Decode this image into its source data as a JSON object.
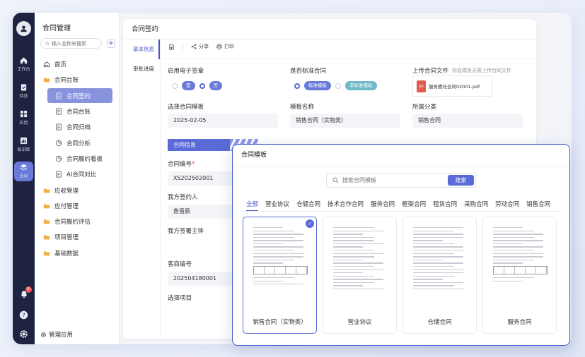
{
  "rail": {
    "items": [
      {
        "label": "工作台",
        "icon": "home-icon"
      },
      {
        "label": "待办",
        "icon": "clipboard-icon"
      },
      {
        "label": "应用",
        "icon": "grid-icon"
      },
      {
        "label": "知识库",
        "icon": "chart-icon"
      },
      {
        "label": "合同",
        "icon": "layers-icon",
        "active": true
      }
    ],
    "notification_count": "9"
  },
  "tree": {
    "title": "合同管理",
    "search_placeholder": "输入名称来搜索",
    "add_label": "+",
    "items": [
      {
        "label": "首页",
        "level": 0,
        "icon": "home-outline-icon"
      },
      {
        "label": "合同台账",
        "level": 0,
        "icon": "folder-icon"
      },
      {
        "label": "合同签约",
        "level": 1,
        "icon": "doc-icon",
        "selected": true
      },
      {
        "label": "合同台账",
        "level": 1,
        "icon": "doc-icon"
      },
      {
        "label": "合同归档",
        "level": 1,
        "icon": "doc-icon"
      },
      {
        "label": "合同分析",
        "level": 1,
        "icon": "pie-icon"
      },
      {
        "label": "合同履约看板",
        "level": 1,
        "icon": "pie-icon"
      },
      {
        "label": "AI合同对比",
        "level": 1,
        "icon": "doc-icon"
      },
      {
        "label": "应收管理",
        "level": 0,
        "icon": "folder-icon"
      },
      {
        "label": "应付管理",
        "level": 0,
        "icon": "folder-icon"
      },
      {
        "label": "合同履约评估",
        "level": 0,
        "icon": "folder-icon"
      },
      {
        "label": "项目管理",
        "level": 0,
        "icon": "folder-icon"
      },
      {
        "label": "基础数据",
        "level": 0,
        "icon": "folder-icon"
      }
    ],
    "footer_label": "管理应用"
  },
  "main": {
    "title": "合同签约",
    "vtabs": [
      {
        "label": "基本信息",
        "active": true
      },
      {
        "label": "审批进度",
        "active": false
      }
    ],
    "toolbar": {
      "share": "分享",
      "print": "打印"
    },
    "fields": {
      "esign_label": "启用电子签章",
      "esign_yes": "是",
      "esign_no": "否",
      "standard_label": "是否标准合同",
      "standard_opt1": "标准模板",
      "standard_opt2": "非标准模板",
      "upload_label": "上传合同文件",
      "upload_hint": "标准模板无需上传合同文件",
      "upload_file": "服务委托合同02001.pdf",
      "pdf_badge": "PDF",
      "template_label": "选择合同模板",
      "template_value": "2025-02-05",
      "template_name_label": "模板名称",
      "template_name_value": "销售合同（实物类）",
      "category_label": "所属分类",
      "category_value": "销售合同",
      "section_title": "合同信息",
      "contract_no_label": "合同编号",
      "contract_no_value": "XS202502001",
      "our_signer_label": "我方签约人",
      "our_signer_value": "詹晋辰",
      "our_subject_label": "我方签署主体",
      "customer_no_label": "客商编号",
      "customer_no_value": "202504180001",
      "project_label": "选择项目"
    }
  },
  "modal": {
    "title": "合同模板",
    "search_placeholder": "搜索合同模板",
    "search_button": "搜索",
    "tabs": [
      "全部",
      "营业协议",
      "仓储合同",
      "技术合作合同",
      "服务合同",
      "框架合同",
      "租赁合同",
      "采购合同",
      "劳动合同",
      "销售合同"
    ],
    "active_tab": 0,
    "cards": [
      {
        "name": "销售合同（实物类）",
        "selected": true
      },
      {
        "name": "营业协议",
        "selected": false
      },
      {
        "name": "仓储合同",
        "selected": false
      },
      {
        "name": "服务合同",
        "selected": false
      }
    ]
  },
  "colors": {
    "accent": "#5a6ad6",
    "rail": "#1d2340",
    "modal_border": "#3b5bcc"
  }
}
